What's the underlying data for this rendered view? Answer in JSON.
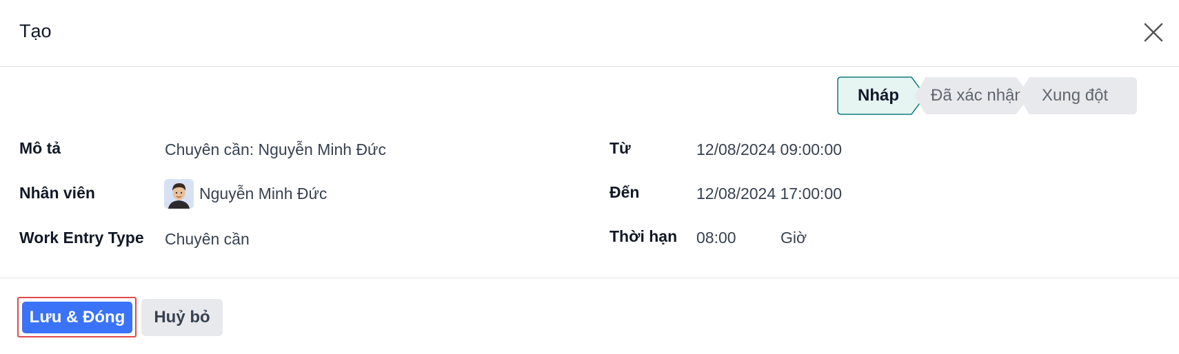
{
  "dialog": {
    "title": "Tạo"
  },
  "statusbar": {
    "stages": [
      {
        "label": "Nháp",
        "active": true
      },
      {
        "label": "Đã xác nhận",
        "active": false
      },
      {
        "label": "Xung đột",
        "active": false
      }
    ]
  },
  "form": {
    "description_label": "Mô tả",
    "description_value": "Chuyên cần: Nguyễn Minh Đức",
    "employee_label": "Nhân viên",
    "employee_value": "Nguyễn Minh Đức",
    "work_entry_type_label": "Work Entry Type",
    "work_entry_type_value": "Chuyên cần",
    "from_label": "Từ",
    "from_value": "12/08/2024 09:00:00",
    "to_label": "Đến",
    "to_value": "12/08/2024 17:00:00",
    "duration_label": "Thời hạn",
    "duration_value": "08:00",
    "duration_unit": "Giờ"
  },
  "footer": {
    "save_close_label": "Lưu & Đóng",
    "cancel_label": "Huỷ bỏ"
  },
  "colors": {
    "primary": "#3a73f7",
    "active_stage_bg": "#e6f4f2",
    "active_stage_border": "#0f7b7b",
    "inactive_stage_bg": "#e8e9ec",
    "highlight_border": "#e04848"
  },
  "icons": {
    "close": "close-icon",
    "avatar": "avatar"
  }
}
